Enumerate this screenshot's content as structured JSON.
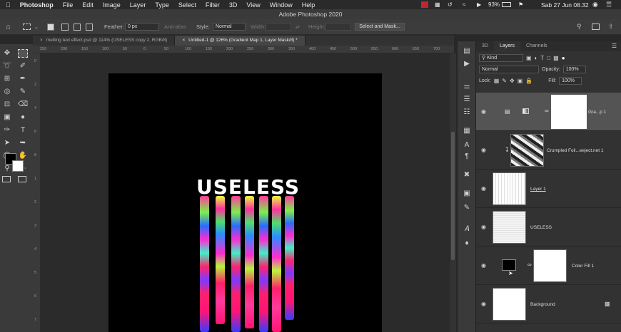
{
  "menubar": {
    "app": "Photoshop",
    "items": [
      "File",
      "Edit",
      "Image",
      "Layer",
      "Type",
      "Select",
      "Filter",
      "3D",
      "View",
      "Window",
      "Help"
    ],
    "battery": "93%",
    "clock": "Sab 27 Jun  08.32"
  },
  "window_title": "Adobe Photoshop 2020",
  "options": {
    "feather_label": "Feather:",
    "feather_value": "0 px",
    "anti_alias": "Anti-alias",
    "style_label": "Style:",
    "style_value": "Normal",
    "width_label": "Width:",
    "height_label": "Height:",
    "select_mask": "Select and Mask..."
  },
  "tabs": [
    {
      "label": "melting text effect.psd @ 114% (USELESS copy 2, RGB/8)",
      "active": false
    },
    {
      "label": "Untitled-1 @ 126% (Gradient Map 1, Layer Mask/8) *",
      "active": true
    }
  ],
  "ruler_top": [
    "250",
    "200",
    "150",
    "100",
    "50",
    "0",
    "50",
    "100",
    "150",
    "200",
    "250",
    "300",
    "350",
    "400",
    "450",
    "500",
    "550",
    "600",
    "650",
    "700"
  ],
  "ruler_left": [
    "0",
    "2",
    "4",
    "6",
    "8",
    "1",
    "2",
    "3",
    "4",
    "5",
    "6",
    "7"
  ],
  "canvas": {
    "text": "USELESS"
  },
  "panel": {
    "tabs": [
      {
        "label": "3D",
        "active": false
      },
      {
        "label": "Layers",
        "active": true
      },
      {
        "label": "Channels",
        "active": false
      }
    ],
    "kind": "Kind",
    "blend": "Normal",
    "opacity_label": "Opacity:",
    "opacity": "100%",
    "lock_label": "Lock:",
    "fill_label": "Fill:",
    "fill": "100%"
  },
  "layers": [
    {
      "name": "Gra...p 1",
      "selected": true
    },
    {
      "name": "Crumpled Foil...eeject.net 1",
      "selected": false
    },
    {
      "name": "Layer 1",
      "selected": false
    },
    {
      "name": "USELESS",
      "selected": false
    },
    {
      "name": "Color Fill 1",
      "selected": false
    },
    {
      "name": "Background",
      "selected": false
    }
  ],
  "colors": {
    "accent": "#ff1f6b",
    "canvas": "#000000",
    "panel": "#323232"
  }
}
